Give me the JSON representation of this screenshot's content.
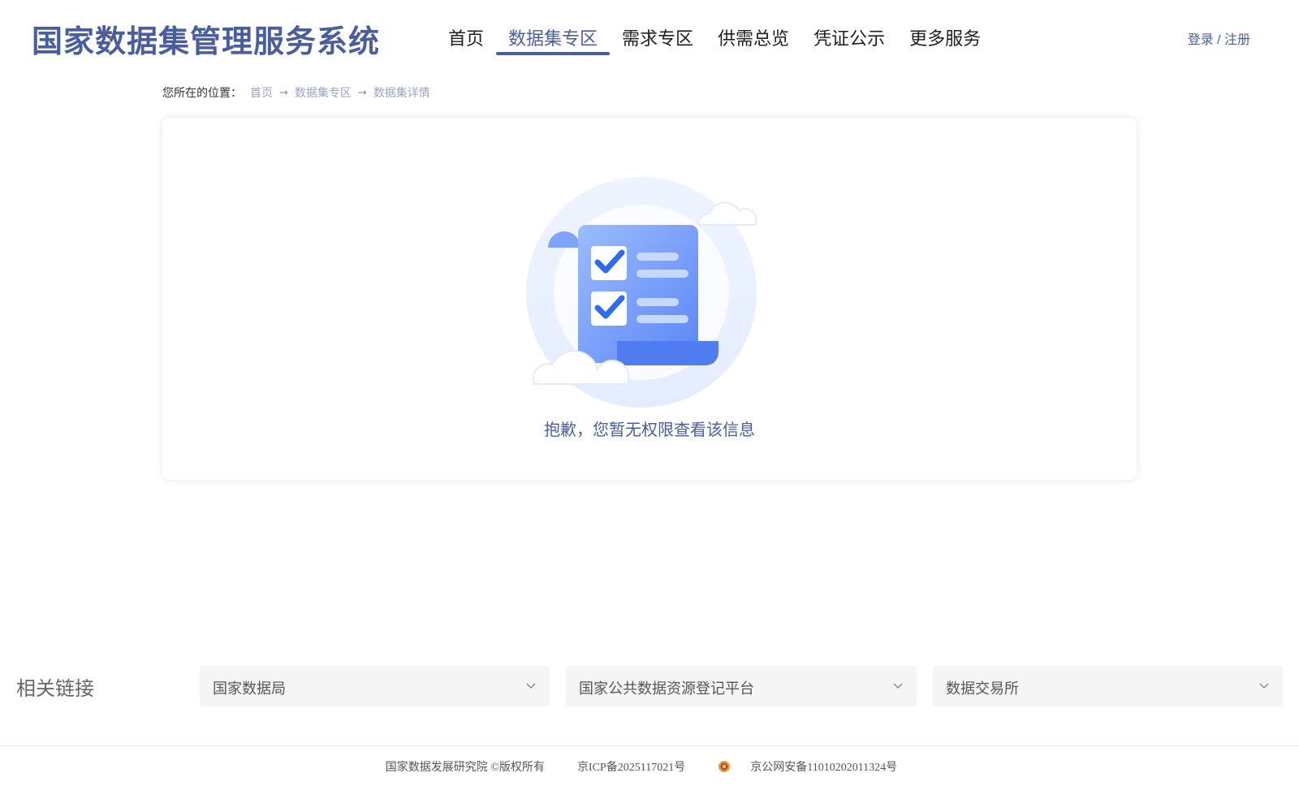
{
  "header": {
    "logo": "国家数据集管理服务系统",
    "nav": [
      "首页",
      "数据集专区",
      "需求专区",
      "供需总览",
      "凭证公示",
      "更多服务"
    ],
    "active_nav": "数据集专区",
    "auth": "登录 / 注册"
  },
  "breadcrumb": {
    "label": "您所在的位置：",
    "items": [
      "首页",
      "数据集专区",
      "数据集详情"
    ]
  },
  "main": {
    "empty_message": "抱歉，您暂无权限查看该信息",
    "illustration_icon": "no-permission-document-icon"
  },
  "related_links": {
    "title": "相关链接",
    "selects": [
      "国家数据局",
      "国家公共数据资源登记平台",
      "数据交易所"
    ]
  },
  "footer": {
    "copyright": "国家数据发展研究院 ©版权所有",
    "icp": "京ICP备2025117021号",
    "police": "京公网安备11010202011324号"
  },
  "colors": {
    "brand": "#4a5e9f",
    "illustration_blue": "#5b86f5"
  }
}
